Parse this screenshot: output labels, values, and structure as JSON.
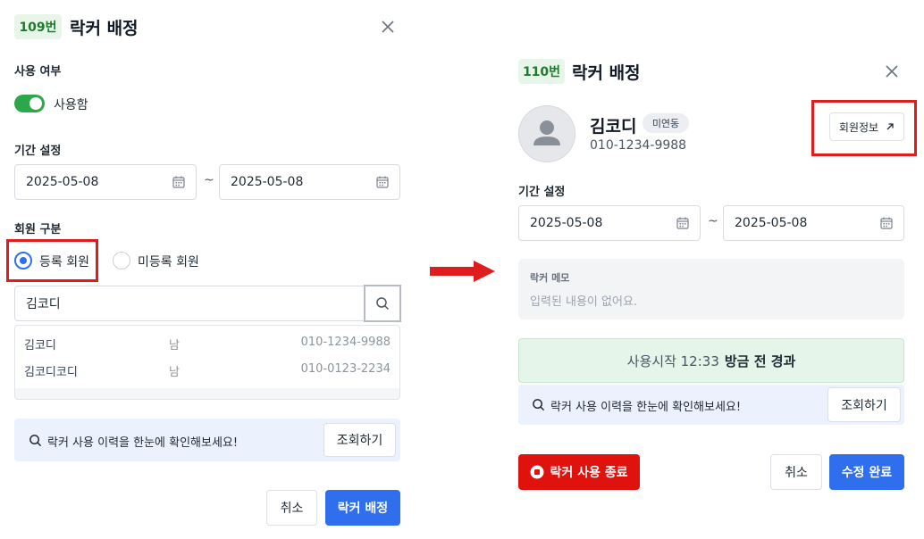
{
  "left_modal": {
    "locker_number": "109번",
    "title": "락커 배정",
    "usage": {
      "label": "사용 여부",
      "toggle_label": "사용함",
      "enabled": true
    },
    "period": {
      "label": "기간 설정",
      "start": "2025-05-08",
      "separator": "~",
      "end": "2025-05-08"
    },
    "member_type": {
      "label": "회원 구분",
      "options": [
        "등록 회원",
        "미등록 회원"
      ],
      "selected": "등록 회원"
    },
    "search": {
      "value": "김코디"
    },
    "results": [
      {
        "name": "김코디",
        "gender": "남",
        "phone": "010-1234-9988"
      },
      {
        "name": "김코디코디",
        "gender": "남",
        "phone": "010-0123-2234"
      }
    ],
    "history_bar": {
      "text": "락커 사용 이력을 한눈에 확인해보세요!",
      "button": "조회하기"
    },
    "footer": {
      "cancel": "취소",
      "submit": "락커 배정"
    }
  },
  "right_modal": {
    "locker_number": "110번",
    "title": "락커 배정",
    "member": {
      "name": "김코디",
      "tag": "미연동",
      "phone": "010-1234-9988"
    },
    "member_info_button": "회원정보",
    "period": {
      "label": "기간 설정",
      "start": "2025-05-08",
      "separator": "~",
      "end": "2025-05-08"
    },
    "memo": {
      "label": "락커 메모",
      "placeholder": "입력된 내용이 없어요."
    },
    "status": {
      "start_text": "사용시작 12:33",
      "elapsed_text": "방금 전 경과"
    },
    "history_bar": {
      "text": "락커 사용 이력을 한눈에 확인해보세요!",
      "button": "조회하기"
    },
    "footer": {
      "end_use": "락커 사용 종료",
      "cancel": "취소",
      "submit": "수정 완료"
    }
  },
  "colors": {
    "accent_blue": "#2f6fed",
    "green_toggle": "#2aa84a",
    "danger_red": "#e0120e",
    "highlight_red": "#e01d1d"
  }
}
